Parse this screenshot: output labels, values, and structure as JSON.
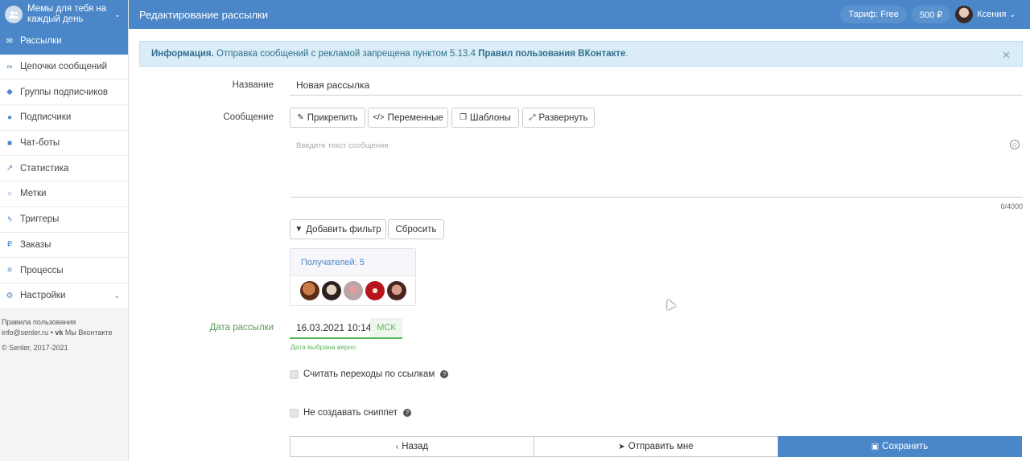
{
  "app": {
    "group_name": "Мемы для тебя на каждый день",
    "page_title": "Редактирование рассылки",
    "plan": "Тариф: Free",
    "balance": "500 ₽",
    "user_name": "Ксения"
  },
  "sidebar": {
    "items": [
      {
        "label": "Рассылки",
        "icon": "mail-icon",
        "glyph": "✉"
      },
      {
        "label": "Цепочки сообщений",
        "icon": "link-icon",
        "glyph": "∞"
      },
      {
        "label": "Группы подписчиков",
        "icon": "tags-icon",
        "glyph": "◆"
      },
      {
        "label": "Подписчики",
        "icon": "users-icon",
        "glyph": "●"
      },
      {
        "label": "Чат-боты",
        "icon": "android-icon",
        "glyph": "■"
      },
      {
        "label": "Статистика",
        "icon": "line-chart-icon",
        "glyph": "↗"
      },
      {
        "label": "Метки",
        "icon": "circle-icon",
        "glyph": "○"
      },
      {
        "label": "Триггеры",
        "icon": "bolt-icon",
        "glyph": "ϟ"
      },
      {
        "label": "Заказы",
        "icon": "ruble-icon",
        "glyph": "₽"
      },
      {
        "label": "Процессы",
        "icon": "tasks-icon",
        "glyph": "≡"
      },
      {
        "label": "Настройки",
        "icon": "cogs-icon",
        "glyph": "⚙"
      }
    ],
    "footer": {
      "rules": "Правила пользования",
      "email": "info@senler.ru",
      "vk": "Мы Вконтакте",
      "copyright": "© Senler, 2017-2021"
    }
  },
  "alert": {
    "title": "Информация.",
    "text": " Отправка сообщений с рекламой запрещена пунктом 5.13.4 ",
    "link": "Правил пользования ВКонтакте",
    "end": "."
  },
  "form": {
    "name_label": "Название",
    "name_value": "Новая рассылка",
    "message_label": "Сообщение",
    "toolbar": {
      "attach": "Прикрепить",
      "variables": "Переменные",
      "templates": "Шаблоны",
      "expand": "Развернуть"
    },
    "message_placeholder": "Введите текст сообщения",
    "counter": "0/4000",
    "add_filter": "Добавить фильтр",
    "reset": "Сбросить",
    "recipients": "Получателей: 5",
    "date_label": "Дата рассылки",
    "date_value": "16.03.2021 10:14",
    "timezone": "МСК",
    "date_hint": "Дата выбрана верно",
    "track_links": "Считать переходы по ссылкам",
    "no_snippet": "Не создавать сниппет"
  },
  "footer_buttons": {
    "back": "Назад",
    "send_me": "Отправить мне",
    "save": "Сохранить"
  }
}
